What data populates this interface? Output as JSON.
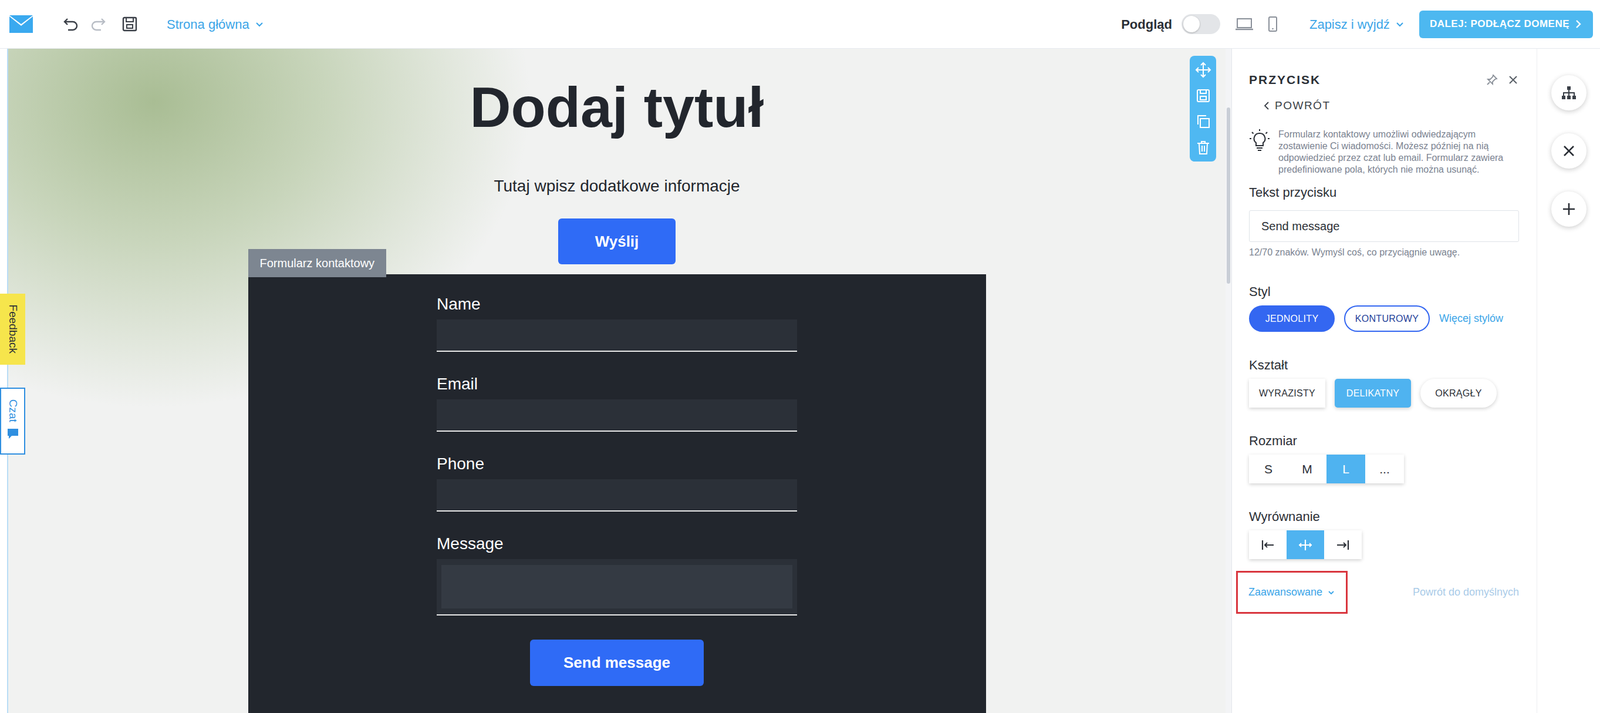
{
  "topbar": {
    "page_menu": "Strona główna",
    "preview": {
      "label": "Podgląd",
      "on": false
    },
    "save_exit": "Zapisz i wyjdź",
    "next_button": "DALEJ: PODŁĄCZ DOMENĘ"
  },
  "side_tabs": [
    {
      "label": "Feedback",
      "color": "#f6e54c"
    },
    {
      "label": "Czat",
      "color": "#2f8fe0"
    }
  ],
  "canvas": {
    "title": "Dodaj tytuł",
    "subtitle": "Tutaj wpisz dodatkowe informacje",
    "button": "Wyślij",
    "form": {
      "label": "Formularz kontaktowy",
      "fields": [
        {
          "label": "Name",
          "kind": "input"
        },
        {
          "label": "Email",
          "kind": "input"
        },
        {
          "label": "Phone",
          "kind": "input"
        },
        {
          "label": "Message",
          "kind": "textarea"
        }
      ],
      "submit": "Send message"
    }
  },
  "panel": {
    "title": "PRZYCISK",
    "back": "POWRÓT",
    "tip": "Formularz kontaktowy umożliwi odwiedzającym zostawienie Ci wiadomości. Możesz później na nią odpowiedzieć przez czat lub email. Formularz zawiera predefiniowane pola, których nie można usunąć.",
    "text_field": {
      "label": "Tekst przycisku",
      "value": "Send message",
      "hint": "12/70 znaków. Wymyśl coś, co przyciągnie uwagę."
    },
    "style": {
      "label": "Styl",
      "options": [
        {
          "label": "JEDNOLITY",
          "selected": true
        },
        {
          "label": "KONTUROWY",
          "selected": false
        }
      ],
      "more": "Więcej stylów"
    },
    "shape": {
      "label": "Kształt",
      "options": [
        {
          "label": "WYRAZISTY",
          "kind": "sharp",
          "selected": false
        },
        {
          "label": "DELIKATNY",
          "kind": "soft",
          "selected": true
        },
        {
          "label": "OKRĄGŁY",
          "kind": "round",
          "selected": false
        }
      ]
    },
    "size": {
      "label": "Rozmiar",
      "options": [
        {
          "label": "S",
          "selected": false
        },
        {
          "label": "M",
          "selected": false
        },
        {
          "label": "L",
          "selected": true
        },
        {
          "label": "...",
          "selected": false
        }
      ]
    },
    "alignment": {
      "label": "Wyrównanie",
      "options": [
        {
          "kind": "left",
          "selected": false
        },
        {
          "kind": "center",
          "selected": true
        },
        {
          "kind": "right",
          "selected": false
        }
      ]
    },
    "advanced": {
      "label": "Zaawansowane",
      "highlighted": true
    },
    "reset": {
      "label": "Powrót do domyślnych",
      "disabled": true
    }
  }
}
